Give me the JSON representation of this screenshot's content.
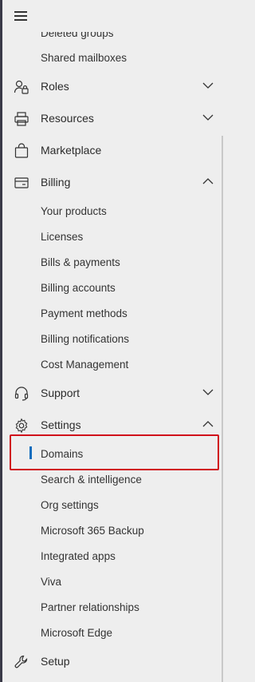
{
  "nav": {
    "items": [
      {
        "label": "Deleted groups",
        "icon": null
      },
      {
        "label": "Shared mailboxes",
        "icon": null
      },
      {
        "label": "Roles",
        "icon": "roles-icon",
        "expand": "chevron-down"
      },
      {
        "label": "Resources",
        "icon": "resources-icon",
        "expand": "chevron-down"
      },
      {
        "label": "Marketplace",
        "icon": "shopping-bag-icon"
      },
      {
        "label": "Billing",
        "icon": "credit-card-icon",
        "expand": "chevron-up"
      },
      {
        "label": "Your products"
      },
      {
        "label": "Licenses"
      },
      {
        "label": "Bills & payments"
      },
      {
        "label": "Billing accounts"
      },
      {
        "label": "Payment methods"
      },
      {
        "label": "Billing notifications"
      },
      {
        "label": "Cost Management"
      },
      {
        "label": "Support",
        "icon": "headset-icon",
        "expand": "chevron-down"
      },
      {
        "label": "Settings",
        "icon": "gear-icon",
        "expand": "chevron-up"
      },
      {
        "label": "Domains",
        "active": true
      },
      {
        "label": "Search & intelligence"
      },
      {
        "label": "Org settings"
      },
      {
        "label": "Microsoft 365 Backup"
      },
      {
        "label": "Integrated apps"
      },
      {
        "label": "Viva"
      },
      {
        "label": "Partner relationships"
      },
      {
        "label": "Microsoft Edge"
      },
      {
        "label": "Setup",
        "icon": "wrench-icon"
      }
    ]
  },
  "colors": {
    "background": "#eeeeee",
    "active_indicator": "#0f6cbd",
    "highlight_box": "#d0101a"
  }
}
